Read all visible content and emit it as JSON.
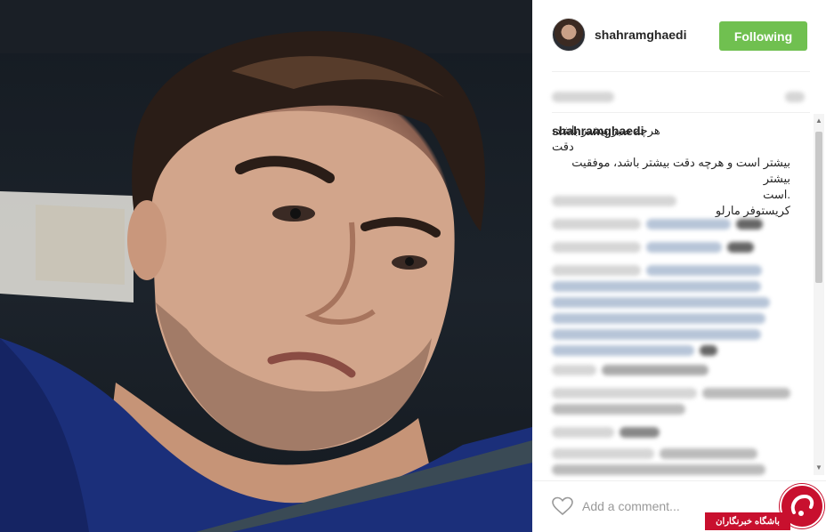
{
  "header": {
    "username": "shahramghaedi",
    "follow_label": "Following"
  },
  "caption": {
    "username": "shahramghaedi",
    "lines": [
      "هرچه صبر بیشتر باشد، دقت",
      "بیشتر است و هرچه دقت بیشتر باشد، موفقیت بیشتر",
      ".است",
      "کریستوفر مارلو"
    ]
  },
  "comment_box": {
    "placeholder": "Add a comment..."
  },
  "watermark": {
    "label": "باشگاه خبرنگاران"
  },
  "colors": {
    "follow_green": "#70c050",
    "watermark_red": "#c8102e"
  },
  "icons": [
    "heart-icon",
    "avatar"
  ]
}
